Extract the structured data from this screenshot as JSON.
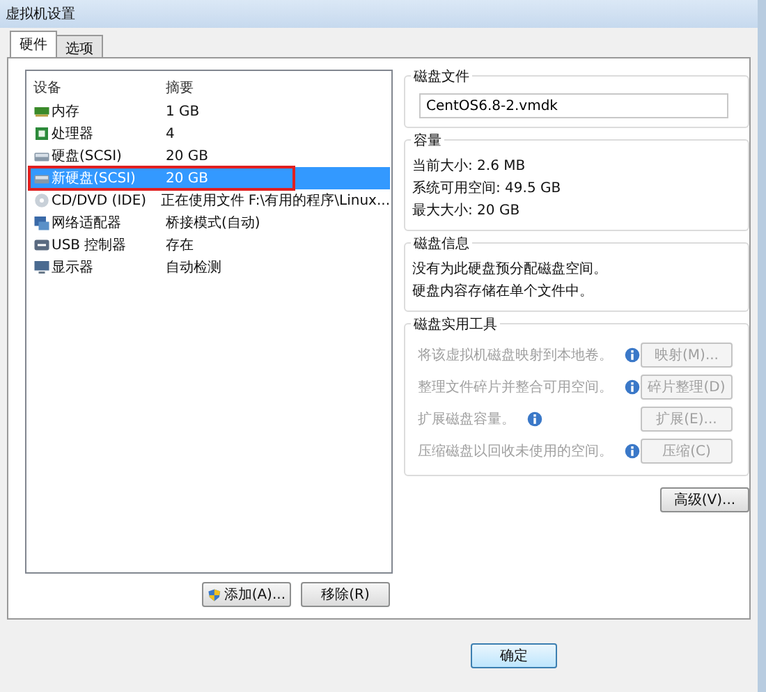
{
  "window": {
    "title": "虚拟机设置"
  },
  "tabs": [
    {
      "label": "硬件",
      "selected": true
    },
    {
      "label": "选项",
      "selected": false
    }
  ],
  "devices": {
    "columns": [
      "设备",
      "摘要"
    ],
    "rows": [
      {
        "kind": "memory",
        "name": "内存",
        "summary": "1 GB",
        "selected": false,
        "highlighted": false
      },
      {
        "kind": "cpu",
        "name": "处理器",
        "summary": "4",
        "selected": false,
        "highlighted": false
      },
      {
        "kind": "disk",
        "name": "硬盘(SCSI)",
        "summary": "20 GB",
        "selected": false,
        "highlighted": false
      },
      {
        "kind": "disk",
        "name": "新硬盘(SCSI)",
        "summary": "20 GB",
        "selected": true,
        "highlighted": true
      },
      {
        "kind": "cd",
        "name": "CD/DVD (IDE)",
        "summary": "正在使用文件 F:\\有用的程序\\Linux...",
        "selected": false,
        "highlighted": false
      },
      {
        "kind": "network",
        "name": "网络适配器",
        "summary": "桥接模式(自动)",
        "selected": false,
        "highlighted": false
      },
      {
        "kind": "usb",
        "name": "USB 控制器",
        "summary": "存在",
        "selected": false,
        "highlighted": false
      },
      {
        "kind": "display",
        "name": "显示器",
        "summary": "自动检测",
        "selected": false,
        "highlighted": false
      }
    ]
  },
  "add_button": "添加(A)...",
  "remove_button": "移除(R)",
  "disk_file": {
    "title": "磁盘文件",
    "value": "CentOS6.8-2.vmdk"
  },
  "capacity": {
    "title": "容量",
    "lines": [
      "当前大小: 2.6 MB",
      "系统可用空间: 49.5 GB",
      "最大大小: 20 GB"
    ]
  },
  "disk_info": {
    "title": "磁盘信息",
    "lines": [
      "没有为此硬盘预分配磁盘空间。",
      "硬盘内容存储在单个文件中。"
    ]
  },
  "utilities": {
    "title": "磁盘实用工具",
    "rows": [
      {
        "text": "将该虚拟机磁盘映射到本地卷。",
        "button": "映射(M)...",
        "disabled": true
      },
      {
        "text": "整理文件碎片并整合可用空间。",
        "button": "碎片整理(D)",
        "disabled": true
      },
      {
        "text": "扩展磁盘容量。",
        "button": "扩展(E)...",
        "disabled": true
      },
      {
        "text": "压缩磁盘以回收未使用的空间。",
        "button": "压缩(C)",
        "disabled": true
      }
    ]
  },
  "advanced_button": "高级(V)...",
  "ok_button": "确定"
}
